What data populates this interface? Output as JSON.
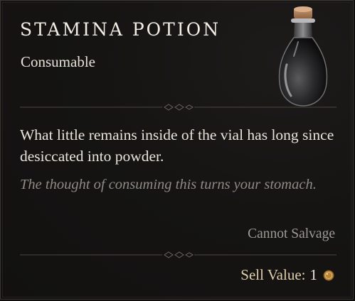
{
  "item": {
    "name": "STAMINA POTION",
    "type": "Consumable",
    "description": "What little remains inside of the vial has long since desiccated into powder.",
    "flavor": "The thought of consuming this turns your stomach.",
    "salvage": "Cannot Salvage",
    "sell_label": "Sell Value:",
    "sell_value": "1"
  },
  "icons": {
    "potion": "stamina-potion-icon",
    "coin": "gold-coin-icon"
  },
  "colors": {
    "title": "#f2eee6",
    "body_text": "#e9e4db",
    "flavor_text": "#8e8a84",
    "sell_label": "#e0cfae"
  }
}
